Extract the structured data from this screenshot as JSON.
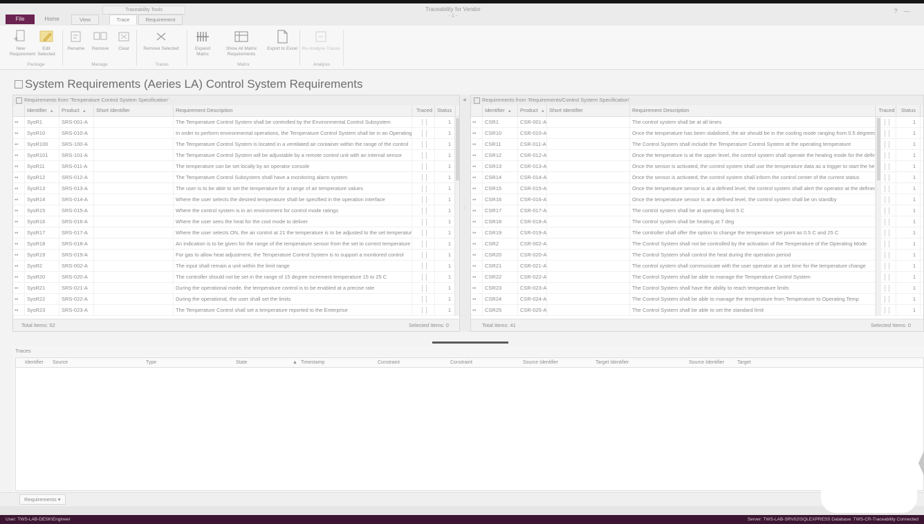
{
  "window": {
    "title": "Traceability for Vendor",
    "subtitle": "- 1 -",
    "controls": [
      "?",
      "—"
    ]
  },
  "tabs": {
    "file": "File",
    "home": "Home",
    "context_group": "Traceability Tools",
    "context_tabs": [
      "View",
      "Trace",
      "Requirement"
    ]
  },
  "ribbon": {
    "buttons": [
      {
        "label": "New Requirement",
        "icon": "new-requirement-icon"
      },
      {
        "label": "Edit Selected",
        "icon": "edit-icon"
      },
      {
        "label": "Rename",
        "icon": "rename-icon"
      },
      {
        "label": "Remove",
        "icon": "remove-icon"
      },
      {
        "label": "Clear",
        "icon": "clear-icon"
      },
      {
        "label": "Remove Selected",
        "icon": "remove-selected-icon"
      },
      {
        "label": "Expand Matrix",
        "icon": "expand-matrix-icon"
      },
      {
        "label": "Show All Matrix Requirements",
        "icon": "show-all-icon"
      },
      {
        "label": "Export to Excel",
        "icon": "export-icon"
      },
      {
        "label": "Re-Analyse Traces",
        "icon": "reanalyse-icon"
      }
    ],
    "groups": [
      "Package",
      "Manage",
      "Traces",
      "Matrix",
      "Analysis"
    ]
  },
  "heading": "System Requirements (Aeries LA) Control System Requirements",
  "left_grid": {
    "caption": "Requirements from 'Temperature Control System Specification'",
    "columns": [
      "Identifier",
      "Product",
      "Short Identifier",
      "Requirement Description",
      "Traced",
      "Status"
    ],
    "footer_left": "Total Items: 52",
    "footer_right": "Selected Items: 0",
    "rows": [
      {
        "id": "SysR1",
        "product": "SRS-001-A",
        "desc": "The Temperature Control System shall be controlled by the Environmental Control Subsystem",
        "status": "1"
      },
      {
        "id": "SysR10",
        "product": "SRS-010-A",
        "desc": "In order to perform environmental operations, the Temperature Control System shall be in an Operating",
        "status": "1"
      },
      {
        "id": "SysR100",
        "product": "SRS-100-A",
        "desc": "The Temperature Control System is located in a ventilated air container within the range of the control",
        "status": "1"
      },
      {
        "id": "SysR101",
        "product": "SRS-101-A",
        "desc": "The Temperature Control System will be adjustable by a remote control unit with an internal sensor",
        "status": "1"
      },
      {
        "id": "SysR11",
        "product": "SRS-011-A",
        "desc": "The temperature can be set locally by an operator console",
        "status": "1"
      },
      {
        "id": "SysR12",
        "product": "SRS-012-A",
        "desc": "The Temperature Control Subsystem shall have a monitoring alarm system",
        "status": "1"
      },
      {
        "id": "SysR13",
        "product": "SRS-013-A",
        "desc": "The user is to be able to set the temperature for a range of air temperature values",
        "status": "1"
      },
      {
        "id": "SysR14",
        "product": "SRS-014-A",
        "desc": "Where the user selects the desired temperature shall be specified in the operation interface",
        "status": "1"
      },
      {
        "id": "SysR15",
        "product": "SRS-015-A",
        "desc": "Where the control system is in an environment for control mode ratings",
        "status": "1"
      },
      {
        "id": "SysR16",
        "product": "SRS-016-A",
        "desc": "Where the user sees the heat for the cool mode to deliver",
        "status": "1"
      },
      {
        "id": "SysR17",
        "product": "SRS-017-A",
        "desc": "Where the user selects ON, the air control at 21 the temperature is to be adjusted to the set temperature",
        "status": "1"
      },
      {
        "id": "SysR18",
        "product": "SRS-018-A",
        "desc": "An indication is to be given for the range of the temperature sensor from the set to correct temperature",
        "status": "1"
      },
      {
        "id": "SysR19",
        "product": "SRS-019-A",
        "desc": "For gas to allow heat adjustment, the Temperature Control System is to support a monitored control",
        "status": "1"
      },
      {
        "id": "SysR2",
        "product": "SRS-002-A",
        "desc": "The input shall remain a unit within the limit range",
        "status": "1"
      },
      {
        "id": "SysR20",
        "product": "SRS-020-A",
        "desc": "The controller should not be set in the range of 15 degree increment temperature 15 to 25 C",
        "status": "1"
      },
      {
        "id": "SysR21",
        "product": "SRS-021-A",
        "desc": "During the operational mode, the temperature control is to be enabled at a precise rate",
        "status": "1"
      },
      {
        "id": "SysR22",
        "product": "SRS-022-A",
        "desc": "During the operational, the user shall set the limits",
        "status": "1"
      },
      {
        "id": "SysR23",
        "product": "SRS-023-A",
        "desc": "The Temperature Control shall set a temperature reported to the Enterprise",
        "status": "1"
      }
    ]
  },
  "right_grid": {
    "caption": "Requirements from 'Requirements/Control System Specification'",
    "columns": [
      "Identifier",
      "Product",
      "Short Identifier",
      "Requirement Description",
      "Traced",
      "Status"
    ],
    "footer_left": "Total Items: 41",
    "footer_right": "Selected Items: 0",
    "rows": [
      {
        "id": "CSR1",
        "product": "CSR-001-A",
        "desc": "The control system shall be at all times",
        "status": "1"
      },
      {
        "id": "CSR10",
        "product": "CSR-010-A",
        "desc": "Once the temperature has been stabilised, the air should be in the cooling mode ranging from 0.5 degrees",
        "status": "1"
      },
      {
        "id": "CSR11",
        "product": "CSR-011-A",
        "desc": "The Control System shall include the Temperature Control System at the operating temperature",
        "status": "1"
      },
      {
        "id": "CSR12",
        "product": "CSR-012-A",
        "desc": "Once the temperature is at the upper level, the control system shall operate the heating mode for the defined period",
        "status": "1"
      },
      {
        "id": "CSR13",
        "product": "CSR-013-A",
        "desc": "Once the sensor is activated, the control system shall use the temperature data as a trigger to start the heater",
        "status": "1"
      },
      {
        "id": "CSR14",
        "product": "CSR-014-A",
        "desc": "Once the sensor is activated, the control system shall inform the control center of the current status",
        "status": "1"
      },
      {
        "id": "CSR15",
        "product": "CSR-015-A",
        "desc": "Once the temperature sensor is at a defined level, the control system shall alert the operator at the defined time",
        "status": "1"
      },
      {
        "id": "CSR16",
        "product": "CSR-016-A",
        "desc": "Once the temperature sensor is at a defined level, the control system shall be on standby",
        "status": "1"
      },
      {
        "id": "CSR17",
        "product": "CSR-017-A",
        "desc": "The control system shall be at operating limit 5 C",
        "status": "1"
      },
      {
        "id": "CSR18",
        "product": "CSR-018-A",
        "desc": "The control system shall be heating at 7 deg",
        "status": "1"
      },
      {
        "id": "CSR19",
        "product": "CSR-019-A",
        "desc": "The controller shall offer the option to change the temperature set point as 0.5 C and 25 C",
        "status": "1"
      },
      {
        "id": "CSR2",
        "product": "CSR-002-A",
        "desc": "The Control System shall not be controlled by the activation of the Temperature of the Operating Mode",
        "status": "1"
      },
      {
        "id": "CSR20",
        "product": "CSR-020-A",
        "desc": "The Control System shall control the heat during the operation period",
        "status": "1"
      },
      {
        "id": "CSR21",
        "product": "CSR-021-A",
        "desc": "The control system shall communicate with the user operator at a set time for the temperature change",
        "status": "1"
      },
      {
        "id": "CSR22",
        "product": "CSR-022-A",
        "desc": "The Control System shall be able to manage the Temperature Control System",
        "status": "1"
      },
      {
        "id": "CSR23",
        "product": "CSR-023-A",
        "desc": "The Control System shall have the ability to reach temperature limits",
        "status": "1"
      },
      {
        "id": "CSR24",
        "product": "CSR-024-A",
        "desc": "The Control System shall be able to manage the temperature from Temperature to Operating Temp",
        "status": "1"
      },
      {
        "id": "CSR25",
        "product": "CSR-025-A",
        "desc": "The Control System shall be able to set the standard limit",
        "status": "1"
      }
    ]
  },
  "traces": {
    "title": "Traces",
    "columns": [
      "Identifier",
      "Source",
      "Type",
      "State",
      "Timestamp",
      "Constraint",
      "Constraint",
      "Source Identifier",
      "Target Identifier",
      "Source Identifier",
      "Target"
    ]
  },
  "bottom_tab": "Requirements ▾",
  "status": {
    "left": "User: TWS-LAB-DESK\\Engineer",
    "right": "Server: TWS-LAB-SRV02\\SQLEXPRESS   Database: TWS-CR-Traceability   Connected"
  },
  "colors": {
    "file_tab": "#6b2350",
    "status_bar": "#3b1531",
    "edit_icon_highlight": "#e9c65a"
  }
}
